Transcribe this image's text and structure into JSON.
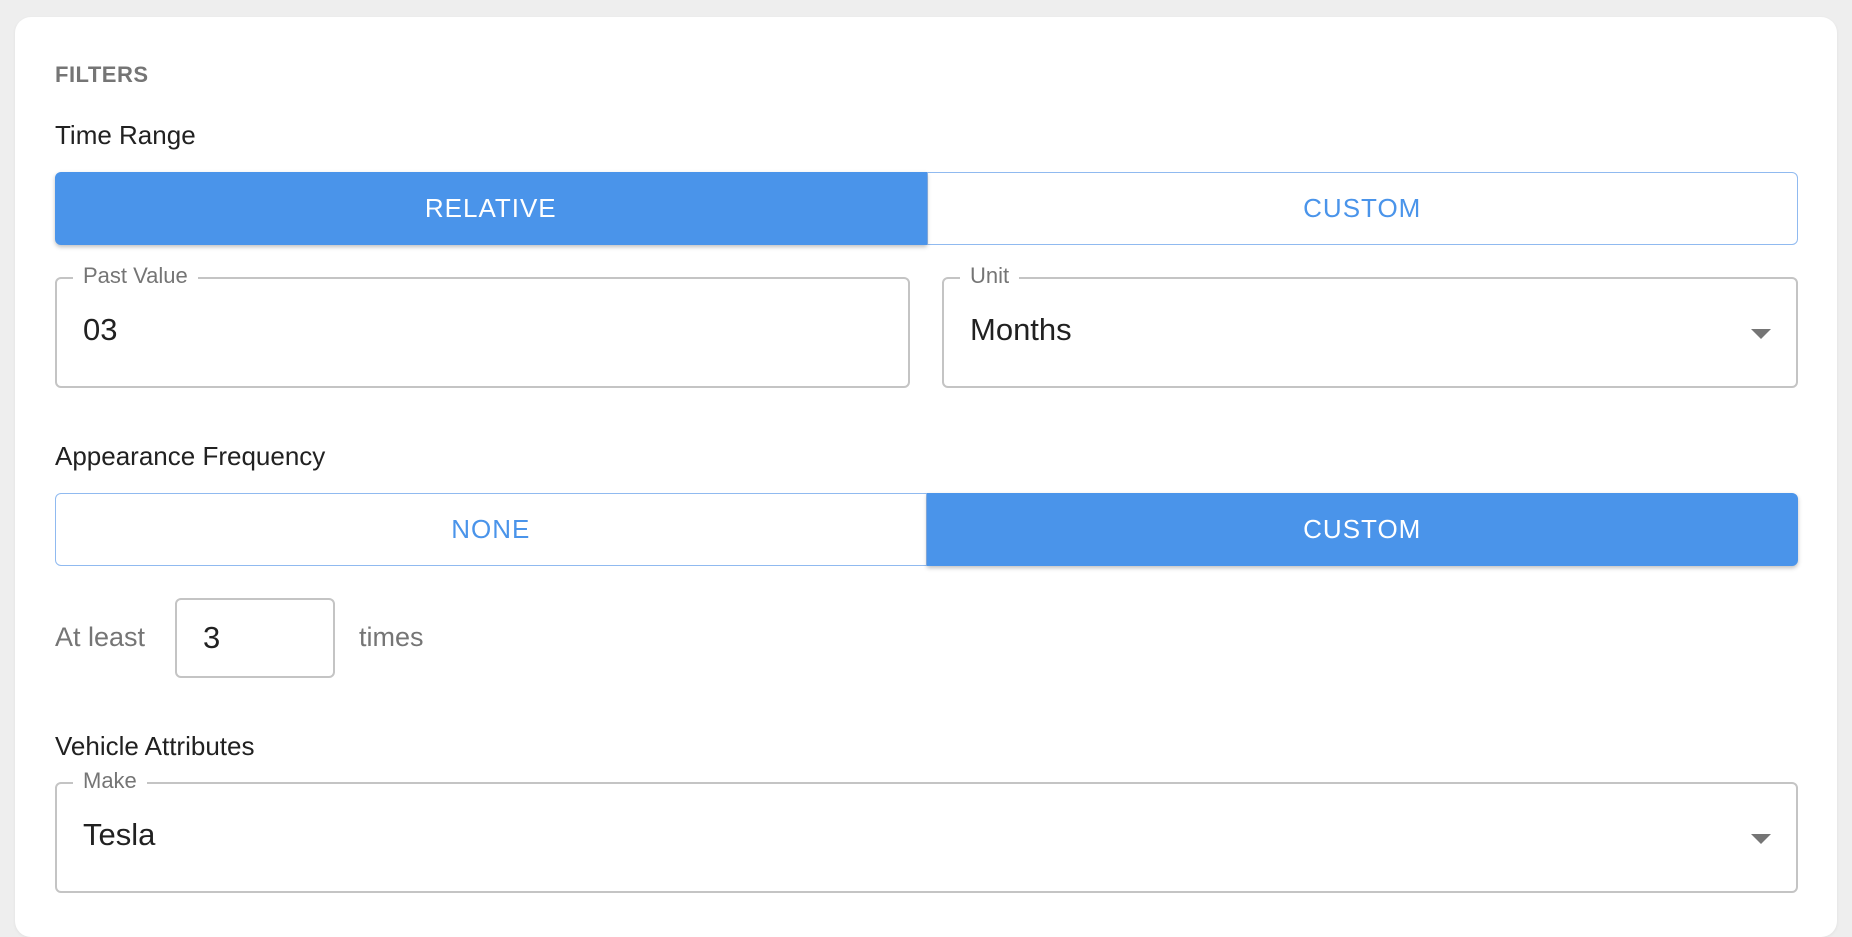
{
  "filters": {
    "heading": "FILTERS"
  },
  "time_range": {
    "label": "Time Range",
    "options": [
      "RELATIVE",
      "CUSTOM"
    ],
    "selected": "RELATIVE",
    "past_value": {
      "legend": "Past Value",
      "value": "03"
    },
    "unit": {
      "legend": "Unit",
      "value": "Months"
    }
  },
  "appearance_frequency": {
    "label": "Appearance Frequency",
    "options": [
      "NONE",
      "CUSTOM"
    ],
    "selected": "CUSTOM",
    "at_least_label": "At least",
    "count": "3",
    "times_label": "times"
  },
  "vehicle_attributes": {
    "label": "Vehicle Attributes",
    "make": {
      "legend": "Make",
      "value": "Tesla"
    }
  },
  "colors": {
    "accent": "#4a94ea",
    "accent_border": "#90baf0",
    "background": "#eeeeee",
    "card": "#ffffff"
  },
  "icons": {
    "dropdown": "caret-down-icon"
  }
}
